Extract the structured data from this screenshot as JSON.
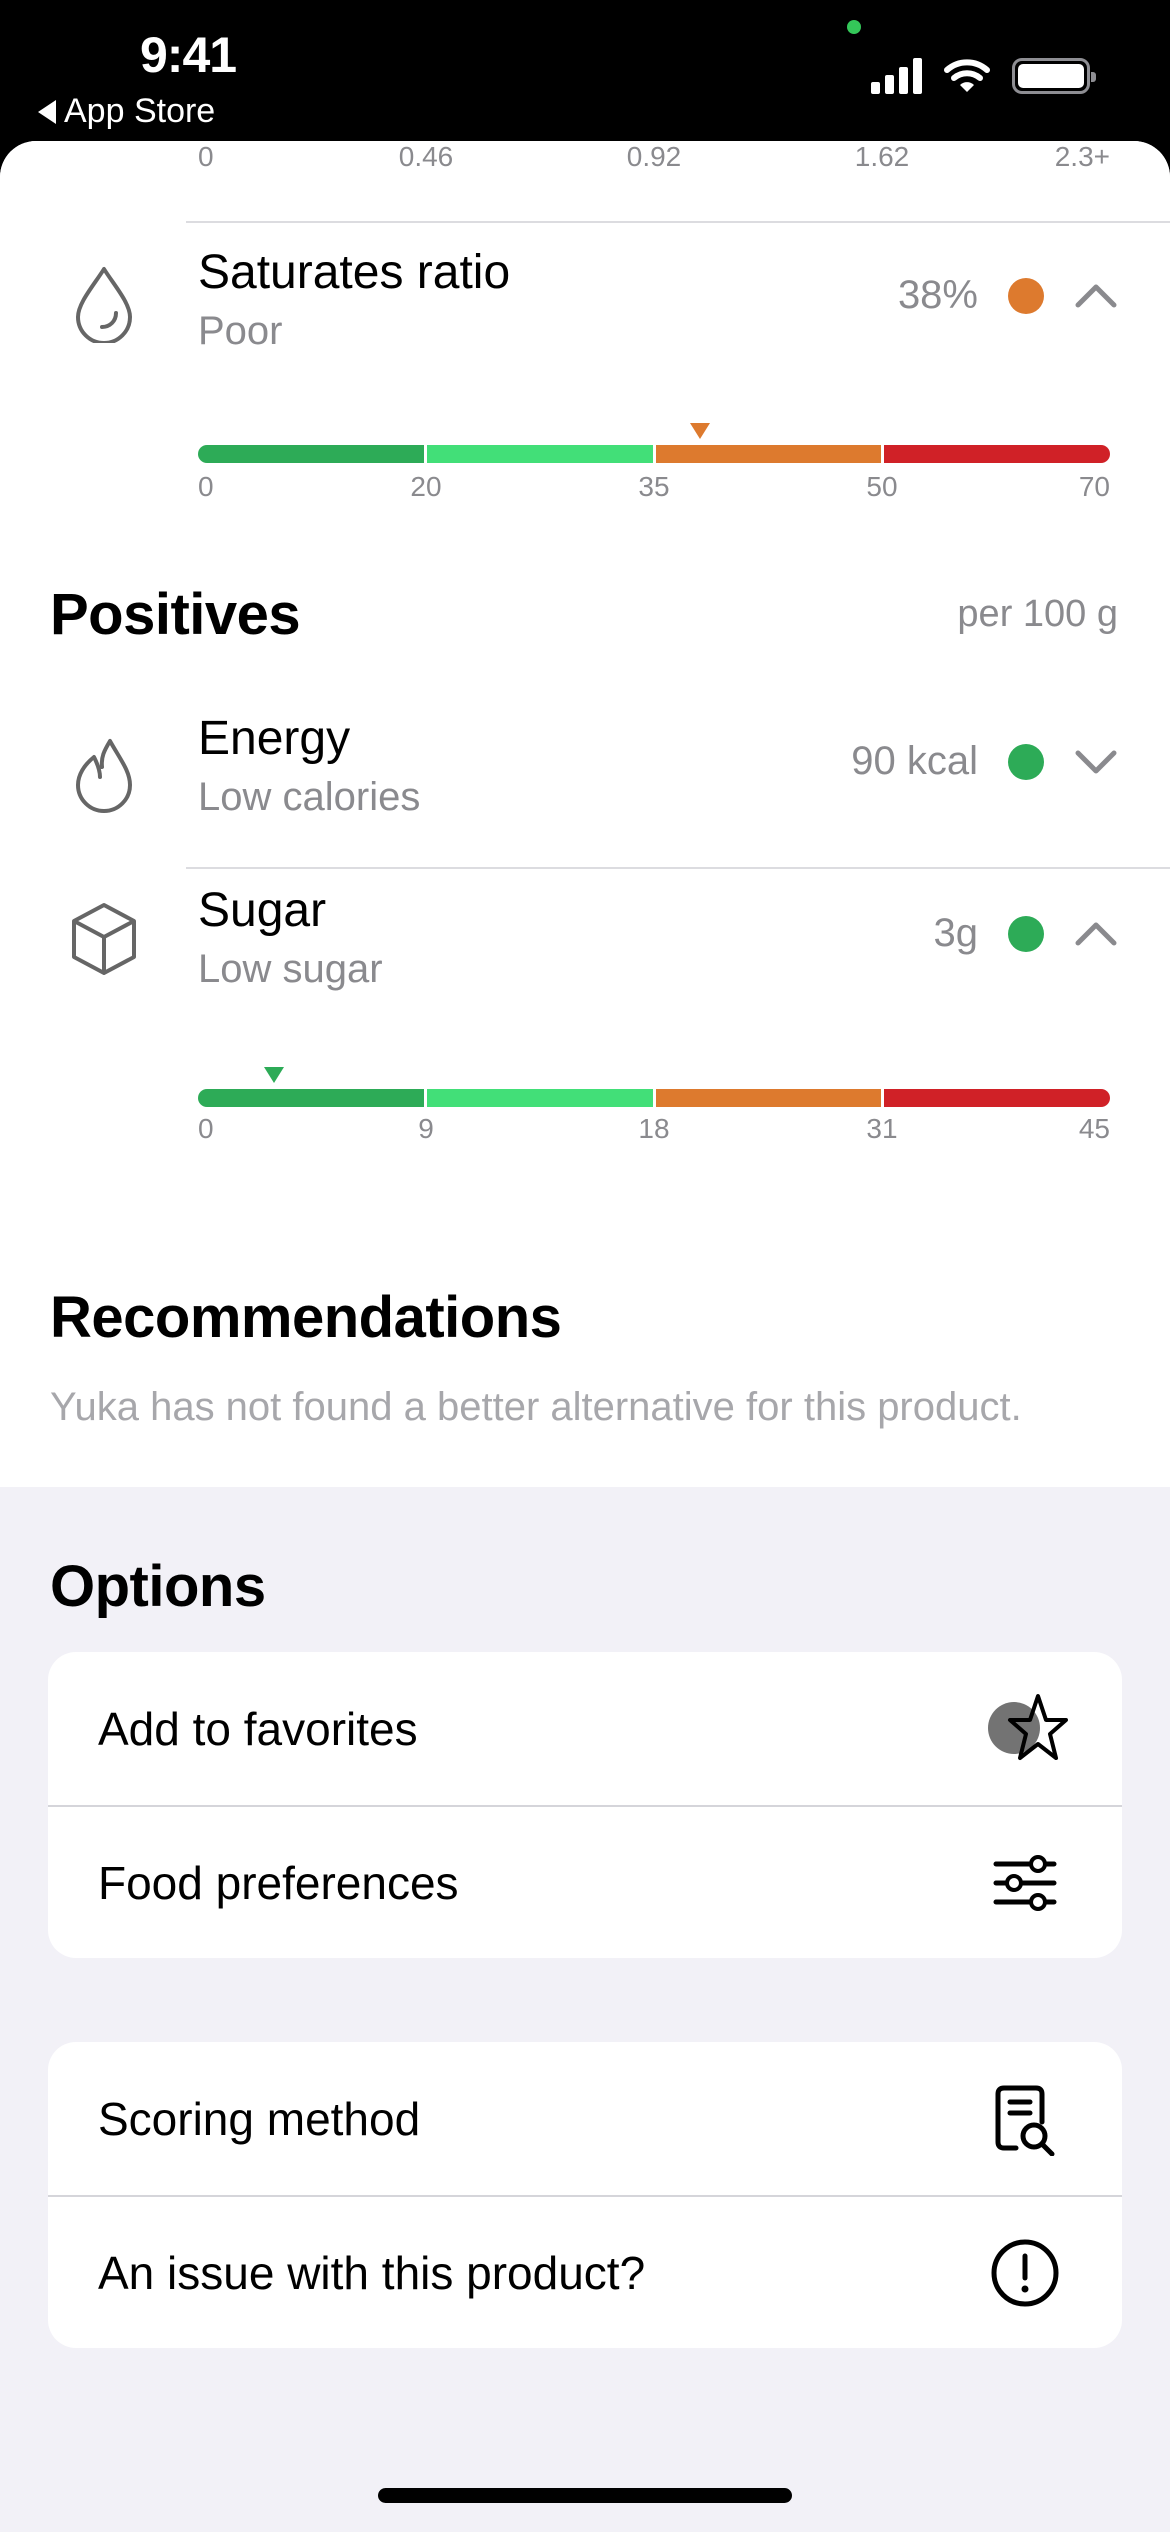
{
  "status_bar": {
    "time": "9:41",
    "back_label": "App Store",
    "icons": [
      "signal-icon",
      "wifi-icon",
      "battery-icon"
    ]
  },
  "colors": {
    "dark_green": "#2dab57",
    "light_green": "#42df78",
    "orange": "#dd7a2e",
    "red": "#d02127",
    "gray_text": "#8a8a8e",
    "sheet_bg": "#f2f1f7"
  },
  "top_scale": {
    "ticks": [
      "0",
      "0.46",
      "0.92",
      "1.62",
      "2.3+"
    ]
  },
  "negatives": {
    "items": [
      {
        "icon": "drop-icon",
        "title": "Saturates ratio",
        "subtitle": "Poor",
        "value": "38%",
        "status_color": "#dd7a2e",
        "expanded": true,
        "gauge": {
          "ticks": [
            "0",
            "20",
            "35",
            "50",
            "70"
          ],
          "marker_value": 38,
          "marker_color": "#dd7a2e",
          "segment_colors": [
            "#2dab57",
            "#42df78",
            "#dd7a2e",
            "#d02127"
          ]
        }
      }
    ]
  },
  "positives": {
    "title": "Positives",
    "unit_label": "per 100 g",
    "items": [
      {
        "icon": "flame-icon",
        "title": "Energy",
        "subtitle": "Low calories",
        "value": "90 kcal",
        "status_color": "#2dab57",
        "expanded": false
      },
      {
        "icon": "sugar-cube-icon",
        "title": "Sugar",
        "subtitle": "Low sugar",
        "value": "3g",
        "status_color": "#2dab57",
        "expanded": true,
        "gauge": {
          "ticks": [
            "0",
            "9",
            "18",
            "31",
            "45"
          ],
          "marker_value": 3,
          "marker_color": "#2dab57",
          "segment_colors": [
            "#2dab57",
            "#42df78",
            "#dd7a2e",
            "#d02127"
          ]
        }
      }
    ]
  },
  "recommendations": {
    "title": "Recommendations",
    "text": "Yuka has not found a better alternative for this product."
  },
  "options": {
    "title": "Options",
    "group1": [
      {
        "label": "Add to favorites",
        "icon": "star-icon"
      },
      {
        "label": "Food preferences",
        "icon": "sliders-icon"
      }
    ],
    "group2": [
      {
        "label": "Scoring method",
        "icon": "document-search-icon"
      },
      {
        "label": "An issue with this product?",
        "icon": "exclamation-circle-icon"
      }
    ]
  }
}
